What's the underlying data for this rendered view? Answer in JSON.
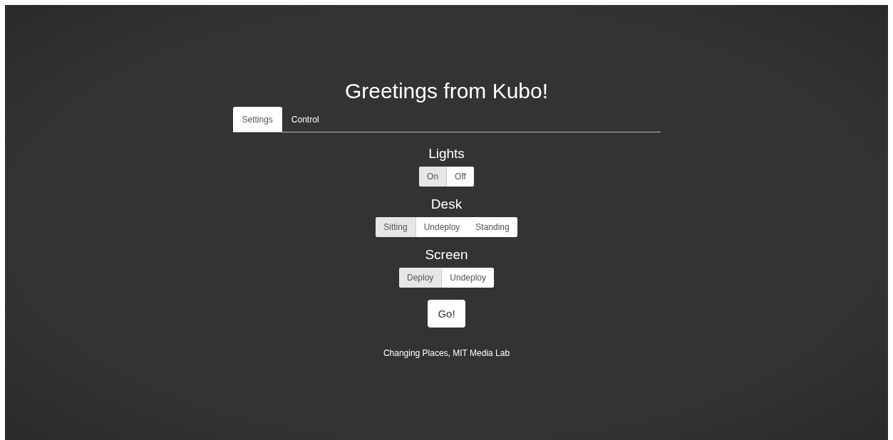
{
  "title": "Greetings from Kubo!",
  "tabs": [
    {
      "label": "Settings",
      "selected": true
    },
    {
      "label": "Control",
      "selected": false
    }
  ],
  "settings": [
    {
      "label": "Lights",
      "options": [
        {
          "label": "On",
          "selected": true
        },
        {
          "label": "Off",
          "selected": false
        }
      ]
    },
    {
      "label": "Desk",
      "options": [
        {
          "label": "Sitting",
          "selected": true
        },
        {
          "label": "Undeploy",
          "selected": false
        },
        {
          "label": "Standing",
          "selected": false
        }
      ]
    },
    {
      "label": "Screen",
      "options": [
        {
          "label": "Deploy",
          "selected": true
        },
        {
          "label": "Undeploy",
          "selected": false
        }
      ]
    }
  ],
  "go_button": "Go!",
  "footer": "Changing Places, MIT Media Lab"
}
